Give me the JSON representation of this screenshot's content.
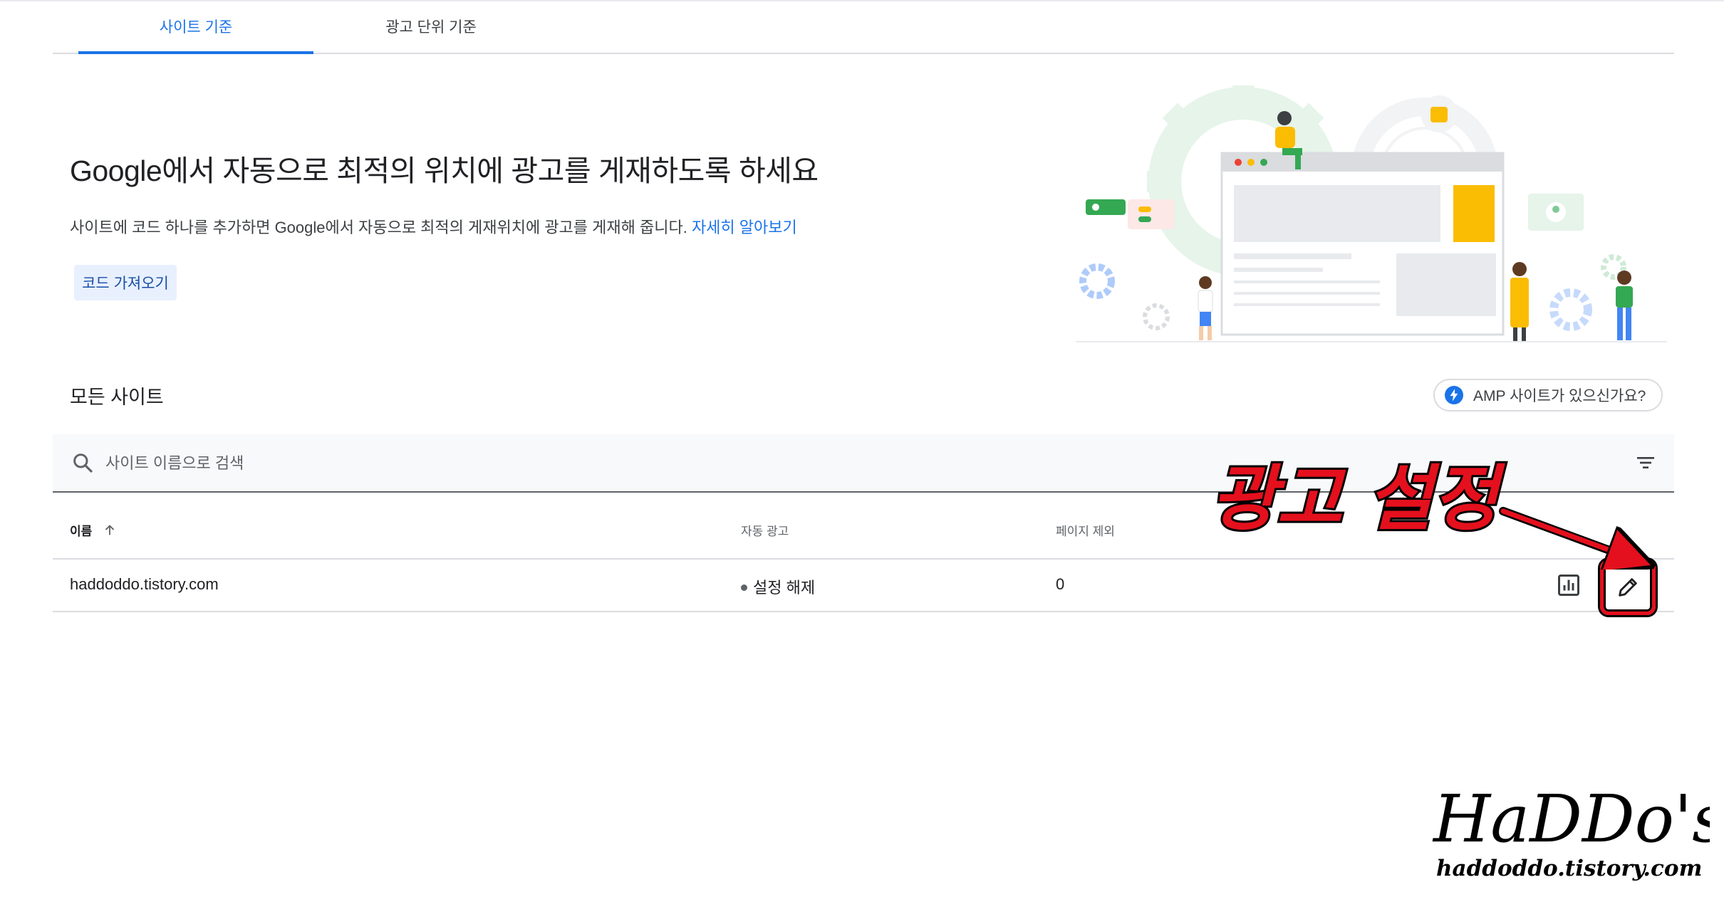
{
  "tabs": [
    {
      "label": "사이트 기준",
      "active": true
    },
    {
      "label": "광고 단위 기준",
      "active": false
    }
  ],
  "hero": {
    "title": "Google에서 자동으로 최적의 위치에 광고를 게재하도록 하세요",
    "description": "사이트에 코드 하나를 추가하면 Google에서 자동으로 최적의 게재위치에 광고를 게재해 줍니다. ",
    "learn_more": "자세히 알아보기",
    "code_button": "코드 가져오기"
  },
  "sites": {
    "title": "모든 사이트",
    "amp_button": "AMP 사이트가 있으신가요?",
    "search_placeholder": "사이트 이름으로 검색",
    "columns": {
      "name": "이름",
      "auto_ads": "자동 광고",
      "page_exclusions": "페이지 제외"
    },
    "rows": [
      {
        "name": "haddoddo.tistory.com",
        "auto_ads": "설정 해제",
        "page_exclusions": "0"
      }
    ]
  },
  "annotation": {
    "label": "광고 설정"
  },
  "watermark": {
    "brand": "HaDDo's",
    "url": "haddoddo.tistory.com"
  },
  "colors": {
    "accent": "#1a73e8",
    "annotation_red": "#e4101d",
    "illustration_yellow": "#fbbc04",
    "illustration_green": "#34a853"
  }
}
